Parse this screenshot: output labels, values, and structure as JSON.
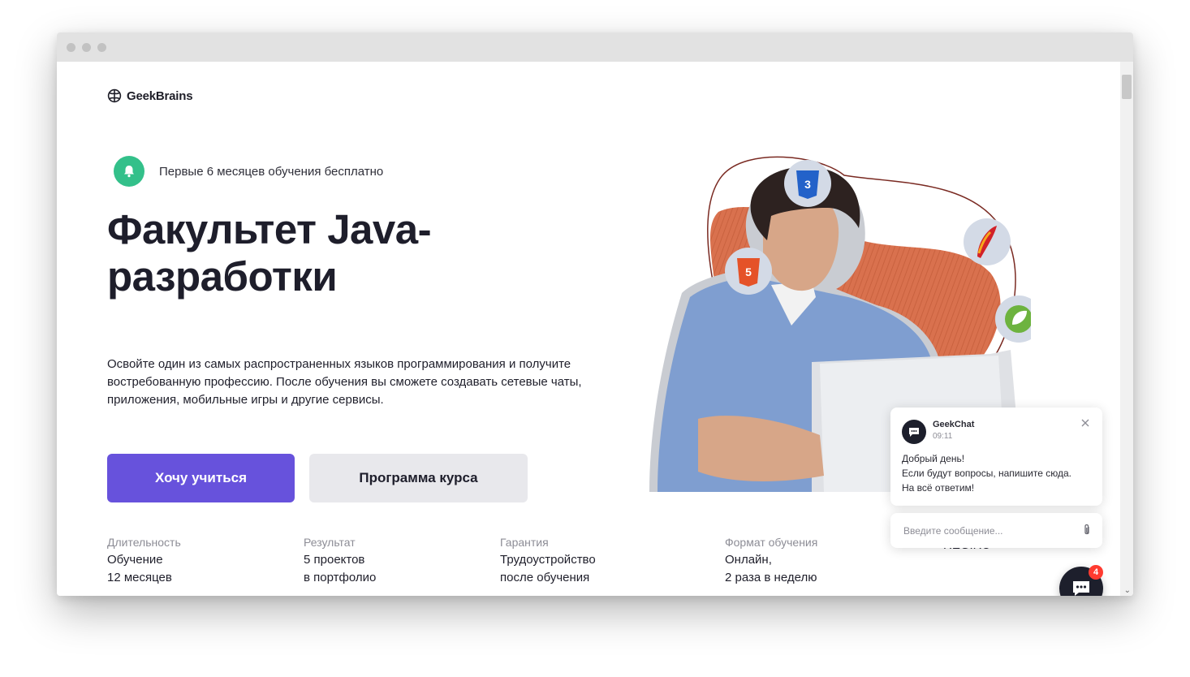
{
  "brand": {
    "name": "GeekBrains"
  },
  "promo": {
    "text": "Первые 6 месяцев обучения бесплатно",
    "icon": "bell-icon",
    "color": "#33c08a"
  },
  "hero": {
    "title": "Факультет Java-разработки",
    "description": "Освойте один из самых распространенных языков программирования и получите востребованную профессию. После обучения вы сможете создавать сетевые чаты, приложения, мобильные игры и другие сервисы.",
    "tech_icons": [
      "css3-icon",
      "html5-icon",
      "apache-feather-icon",
      "spring-leaf-icon"
    ]
  },
  "buttons": {
    "primary": "Хочу учиться",
    "secondary": "Программа курса"
  },
  "stats": [
    {
      "label": "Длительность",
      "line1": "Обучение",
      "line2": "12 месяцев"
    },
    {
      "label": "Результат",
      "line1": "5 проектов",
      "line2": "в портфолио"
    },
    {
      "label": "Гарантия",
      "line1": "Трудоустройство",
      "line2": "после обучения"
    },
    {
      "label": "Формат обучения",
      "line1": "Онлайн,",
      "line2": "2 раза в неделю"
    },
    {
      "label": "",
      "line1": "REG.RU",
      "line2": ""
    }
  ],
  "chat": {
    "name": "GeekChat",
    "time": "09:11",
    "message": [
      "Добрый день!",
      "Если будут вопросы, напишите сюда.",
      "На всё ответим!"
    ],
    "input_placeholder": "Введите сообщение...",
    "badge_count": "4"
  },
  "colors": {
    "accent": "#6752dc",
    "secondary_button": "#e8e8ec",
    "hero_blob": "#d9714e",
    "chat_dark": "#1d1f2c",
    "badge": "#ff3b30"
  }
}
